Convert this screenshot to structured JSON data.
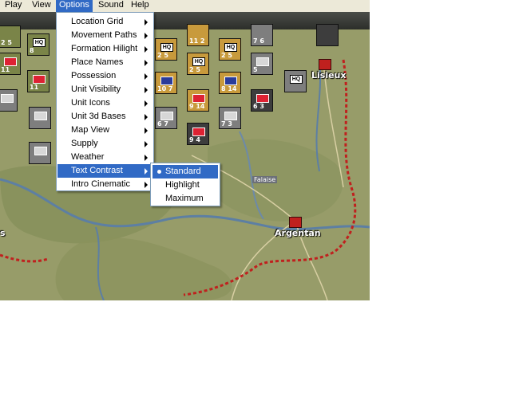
{
  "menubar": {
    "items": [
      "Play",
      "View",
      "Options",
      "Sound",
      "Help"
    ],
    "active": "Options"
  },
  "options_menu": {
    "items": [
      {
        "label": "Location Grid",
        "submenu": true
      },
      {
        "label": "Movement Paths",
        "submenu": true
      },
      {
        "label": "Formation Hilight",
        "submenu": true
      },
      {
        "label": "Place Names",
        "submenu": true
      },
      {
        "label": "Possession",
        "submenu": true
      },
      {
        "label": "Unit Visibility",
        "submenu": true
      },
      {
        "label": "Unit Icons",
        "submenu": true
      },
      {
        "label": "Unit 3d Bases",
        "submenu": true
      },
      {
        "label": "Map View",
        "submenu": true
      },
      {
        "label": "Supply",
        "submenu": true
      },
      {
        "label": "Weather",
        "submenu": true
      },
      {
        "label": "Text Contrast",
        "submenu": true,
        "highlighted": true
      },
      {
        "label": "Intro Cinematic",
        "submenu": true
      }
    ]
  },
  "text_contrast_submenu": {
    "items": [
      {
        "label": "Standard",
        "selected": true
      },
      {
        "label": "Highlight",
        "selected": false
      },
      {
        "label": "Maximum",
        "selected": false
      }
    ]
  },
  "map": {
    "place_names": [
      "Lisieux",
      "Argentan",
      "Falaise",
      "s"
    ],
    "counter_values": [
      "2 5",
      "8",
      "11",
      "2 5",
      "5",
      "10 7",
      "8 14",
      "9 14",
      "6 3",
      "6 7",
      "7 3",
      "9 4",
      "7 6",
      "11 2"
    ],
    "hq_label": "HQ"
  },
  "colors": {
    "highlight": "#316ac5",
    "menubar": "#ece9d8",
    "road_border": "#c0201e"
  }
}
